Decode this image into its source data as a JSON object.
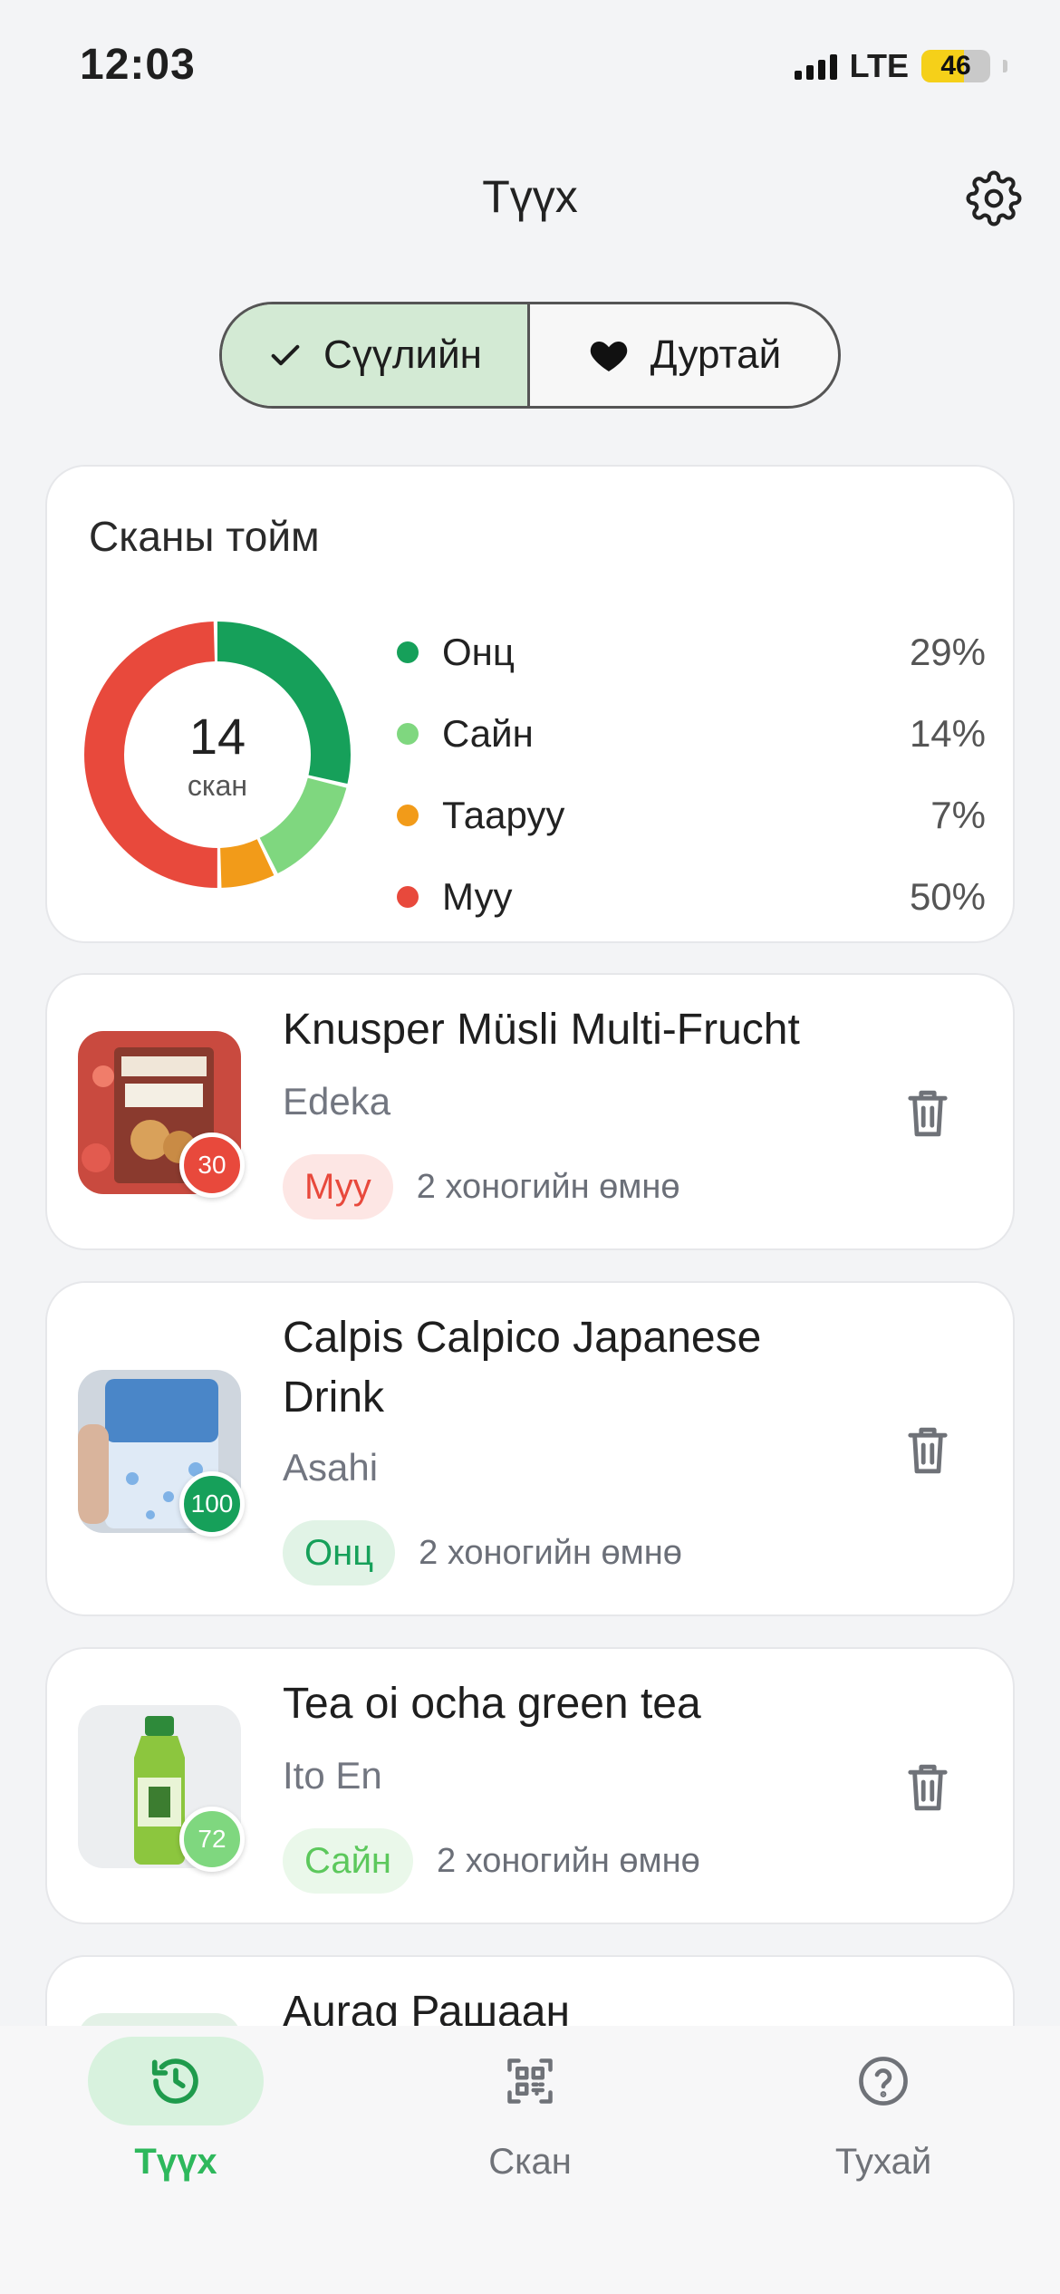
{
  "status_bar": {
    "time": "12:03",
    "network": "LTE",
    "battery": "46"
  },
  "header": {
    "title": "Түүх",
    "settings_icon": "gear-icon"
  },
  "tabs": [
    {
      "label": "Сүүлийн",
      "icon": "check-icon",
      "selected": true
    },
    {
      "label": "Дуртай",
      "icon": "heart-icon",
      "selected": false
    }
  ],
  "summary": {
    "title": "Сканы тойм",
    "total": "14",
    "total_unit": "скан",
    "items": [
      {
        "label": "Онц",
        "percent": "29%",
        "color": "#16a05a"
      },
      {
        "label": "Сайн",
        "percent": "14%",
        "color": "#7fd77f"
      },
      {
        "label": "Тааруу",
        "percent": "7%",
        "color": "#f29b19"
      },
      {
        "label": "Муу",
        "percent": "50%",
        "color": "#e8493c"
      }
    ]
  },
  "products": [
    {
      "name": "Knusper Müsli Multi-Frucht",
      "brand": "Edeka",
      "score": "30",
      "rating": "Муу",
      "rating_color": "#e8493c",
      "rating_bg": "#fde6e4",
      "time": "2 хоногийн өмнө"
    },
    {
      "name": "Calpis Calpico Japanese Drink",
      "brand": "Asahi",
      "score": "100",
      "rating": "Онц",
      "rating_color": "#16a05a",
      "rating_bg": "#e1f3e6",
      "time": "2 хоногийн өмнө"
    },
    {
      "name": "Tea oi ocha green tea",
      "brand": "Ito En",
      "score": "72",
      "rating": "Сайн",
      "rating_color": "#5cc85c",
      "rating_bg": "#eaf8ea",
      "time": "2 хоногийн өмнө"
    },
    {
      "name": "Aurag Рашаан"
    }
  ],
  "bottom_nav": [
    {
      "label": "Түүх",
      "icon": "history-icon",
      "active": true
    },
    {
      "label": "Скан",
      "icon": "qr-scan-icon",
      "active": false
    },
    {
      "label": "Тухай",
      "icon": "help-icon",
      "active": false
    }
  ],
  "colors": {
    "accent": "#2eb85c",
    "accent_light": "#d8f2de"
  }
}
